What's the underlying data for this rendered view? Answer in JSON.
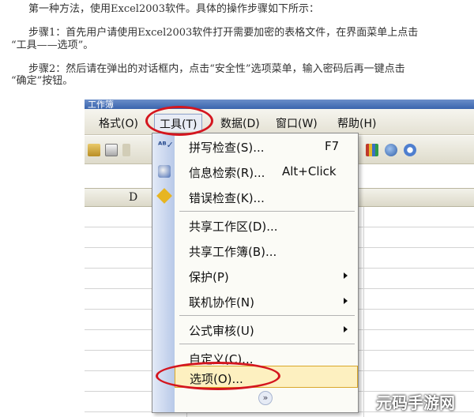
{
  "article": {
    "p1": "第一种方法，使用Excel2003软件。具体的操作步骤如下所示：",
    "p2_line1": "步骤1：首先用户请使用Excel2003软件打开需要加密的表格文件，在界面菜单上点击",
    "p2_line2": "“工具——选项”。",
    "p3_line1": "步骤2：然后请在弹出的对话框内，点击“安全性”选项菜单，输入密码后再一键点击",
    "p3_line2": "“确定”按钮。"
  },
  "window": {
    "title_fragment": "工作簿"
  },
  "menubar": {
    "format": "格式(O)",
    "tools": "工具(T)",
    "data": "数据(D)",
    "window": "窗口(W)",
    "help": "帮助(H)"
  },
  "sheet": {
    "column_d": "D"
  },
  "tools_menu": {
    "items": [
      {
        "label": "拼写检查(S)...",
        "shortcut": "F7",
        "icon": "spell-check-icon"
      },
      {
        "label": "信息检索(R)...",
        "shortcut": "Alt+Click",
        "icon": "research-icon"
      },
      {
        "label": "错误检查(K)...",
        "icon": "error-check-icon"
      },
      {
        "label": "共享工作区(D)..."
      },
      {
        "label": "共享工作簿(B)..."
      },
      {
        "label": "保护(P)",
        "submenu": true
      },
      {
        "label": "联机协作(N)",
        "submenu": true
      },
      {
        "label": "公式审核(U)",
        "submenu": true
      },
      {
        "label": "自定义(C)..."
      },
      {
        "label": "选项(O)...",
        "highlighted": true
      }
    ],
    "more_glyph": "»",
    "spell_glyph": "ᴬᴮ✓"
  },
  "annotation_color": "#d4161f",
  "watermark": "元码手游网"
}
